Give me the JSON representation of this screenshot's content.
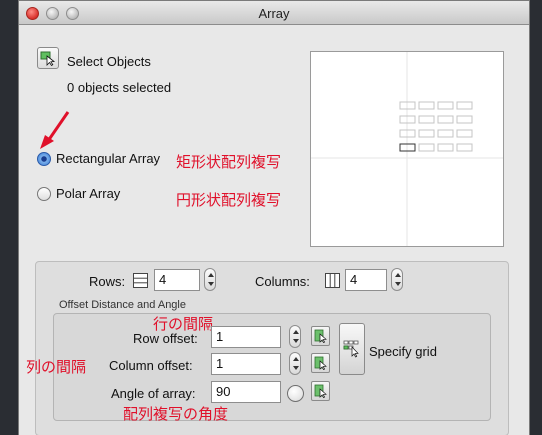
{
  "window": {
    "title": "Array"
  },
  "select_objects": {
    "label": "Select Objects",
    "count_text": "0 objects selected"
  },
  "array_type": {
    "rectangular_label": "Rectangular Array",
    "polar_label": "Polar Array",
    "selected": "rectangular"
  },
  "annotations": {
    "rectangular": "矩形状配列複写",
    "polar": "円形状配列複写",
    "row_offset": "行の間隔",
    "column_offset": "列の間隔",
    "angle": "配列複写の角度",
    "arrow_color": "#e0102a"
  },
  "grid": {
    "rows_label": "Rows:",
    "rows_value": "4",
    "columns_label": "Columns:",
    "columns_value": "4"
  },
  "offset": {
    "group_label": "Offset Distance and Angle",
    "row_offset_label": "Row offset:",
    "row_offset_value": "1",
    "column_offset_label": "Column offset:",
    "column_offset_value": "1",
    "angle_label": "Angle of array:",
    "angle_value": "90",
    "specify_grid_label": "Specify grid"
  },
  "icons": {
    "select": "select-objects-icon",
    "rows": "rows-icon",
    "columns": "columns-icon",
    "pick": "pick-point-icon",
    "specify_grid": "specify-grid-icon",
    "angle_dial": "angle-dial-icon"
  }
}
